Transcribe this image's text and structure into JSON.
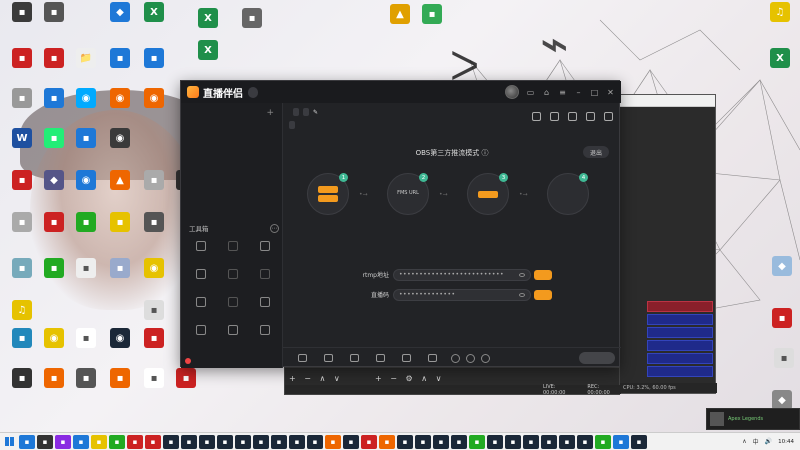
{
  "app": {
    "name": "直播伴侣",
    "version": "",
    "title_icons": [
      "avatar-icon",
      "message-icon",
      "shirt-icon",
      "menu-icon",
      "minimize-icon",
      "maximize-icon",
      "close-icon"
    ]
  },
  "sidebar": {
    "tabs": [
      "",
      "",
      ""
    ],
    "empty_hint": "",
    "tools_title": "工具箱",
    "tools": [
      {
        "label": "",
        "icon": "scene-icon"
      },
      {
        "label": "",
        "icon": "timer-icon"
      },
      {
        "label": "",
        "icon": "voice-icon"
      },
      {
        "label": "",
        "icon": "broadcast-icon"
      },
      {
        "label": "",
        "icon": "gift-icon"
      },
      {
        "label": "",
        "icon": "user-icon"
      },
      {
        "label": "",
        "icon": "tool-icon"
      },
      {
        "label": "",
        "icon": "list-icon"
      },
      {
        "label": "",
        "icon": "record-icon"
      },
      {
        "label": "",
        "icon": "chart-icon"
      },
      {
        "label": "",
        "icon": "hot-icon"
      },
      {
        "label": "",
        "icon": "upload-icon"
      }
    ],
    "footer_text": ""
  },
  "room": {
    "title": "",
    "tag1": "",
    "tag2": "",
    "badge": "",
    "meta1": "",
    "meta2": "",
    "meta3": ""
  },
  "obs_mode": {
    "title": "OBS第三方推流模式",
    "exit_label": "退出",
    "steps": [
      {
        "num": "1",
        "chips": [
          "",
          ""
        ],
        "text": "",
        "caption": ""
      },
      {
        "num": "2",
        "chips": [],
        "text": "FMS URL",
        "text2": "",
        "caption": ""
      },
      {
        "num": "3",
        "chips": [
          ""
        ],
        "text": "",
        "caption": ""
      },
      {
        "num": "4",
        "chips": [],
        "text": "",
        "caption": ""
      }
    ],
    "rtmp_label": "rtmp地址",
    "rtmp_value": "••••••••••••••••••••••••••",
    "key_label": "直播码",
    "key_value": "••••••••••••••",
    "copy_label": "",
    "hint": ""
  },
  "bottom_bar": {
    "items": [
      "",
      "",
      "",
      "",
      "",
      ""
    ],
    "start_label": ""
  },
  "obs": {
    "controls_header": "",
    "buttons": [
      "",
      "",
      "",
      "",
      "",
      ""
    ],
    "status_live": "LIVE: 00:00:00",
    "status_rec": "REC: 00:00:00",
    "status_cpu": "CPU: 3.2%, 60.00 fps",
    "under_controls_a": "+ − ∧ ∨",
    "under_controls_b": "+ − ⚙ ∧ ∨"
  },
  "desktop_icons": [
    {
      "label": "",
      "color": "#3b3b3b",
      "glyph": "▪"
    },
    {
      "label": "",
      "color": "#555",
      "glyph": "▪"
    },
    {
      "label": "",
      "color": "#1e78d7",
      "glyph": "◆"
    },
    {
      "label": "",
      "color": "#1f8f4a",
      "glyph": "X"
    },
    {
      "label": "",
      "color": "#1f8f4a",
      "glyph": "X"
    },
    {
      "label": "",
      "color": "#666",
      "glyph": "▪"
    },
    {
      "label": "",
      "color": "#e0a000",
      "glyph": "▲"
    },
    {
      "label": "",
      "color": "#3a5",
      "glyph": "▪"
    },
    {
      "label": "",
      "color": "#e6c200",
      "glyph": "♫"
    },
    {
      "label": "",
      "color": "#c22",
      "glyph": "▪"
    },
    {
      "label": "",
      "color": "#c22",
      "glyph": "▪"
    },
    {
      "label": "",
      "color": "#eee",
      "glyph": "📁"
    },
    {
      "label": "",
      "color": "#1e78d7",
      "glyph": "▪"
    },
    {
      "label": "",
      "color": "#1e78d7",
      "glyph": "▪"
    },
    {
      "label": "",
      "color": "#1f8f4a",
      "glyph": "X"
    },
    {
      "label": "",
      "color": "#1f8f4a",
      "glyph": "X"
    },
    {
      "label": "",
      "color": "#999",
      "glyph": "▪"
    },
    {
      "label": "",
      "color": "#1e78d7",
      "glyph": "▪"
    },
    {
      "label": "",
      "color": "#0af",
      "glyph": "◉"
    },
    {
      "label": "",
      "color": "#e60",
      "glyph": "◉"
    },
    {
      "label": "",
      "color": "#e60",
      "glyph": "◉"
    },
    {
      "label": "",
      "color": "#1e50a0",
      "glyph": "W"
    },
    {
      "label": "",
      "color": "#2e7",
      "glyph": "▪"
    },
    {
      "label": "",
      "color": "#1e78d7",
      "glyph": "▪"
    },
    {
      "label": "",
      "color": "#3a3a3a",
      "glyph": "◉"
    },
    {
      "label": "",
      "color": "#c22",
      "glyph": "▪"
    },
    {
      "label": "",
      "color": "#558",
      "glyph": "◆"
    },
    {
      "label": "",
      "color": "#1e78d7",
      "glyph": "◉"
    },
    {
      "label": "",
      "color": "#e60",
      "glyph": "▲"
    },
    {
      "label": "",
      "color": "#aaa",
      "glyph": "▪"
    },
    {
      "label": "",
      "color": "#333",
      "glyph": "▪"
    },
    {
      "label": "",
      "color": "#aaa",
      "glyph": "▪"
    },
    {
      "label": "",
      "color": "#c22",
      "glyph": "▪"
    },
    {
      "label": "",
      "color": "#2a2",
      "glyph": "▪"
    },
    {
      "label": "",
      "color": "#e6c200",
      "glyph": "▪"
    },
    {
      "label": "",
      "color": "#555",
      "glyph": "▪"
    },
    {
      "label": "",
      "color": "#7ab",
      "glyph": "▪"
    },
    {
      "label": "",
      "color": "#2a2",
      "glyph": "▪"
    },
    {
      "label": "",
      "color": "#eee",
      "glyph": "▪"
    },
    {
      "label": "",
      "color": "#9ac",
      "glyph": "▪"
    },
    {
      "label": "",
      "color": "#e6c200",
      "glyph": "◉"
    },
    {
      "label": "",
      "color": "#28b",
      "glyph": "▪"
    },
    {
      "label": "",
      "color": "#e6c200",
      "glyph": "◉"
    },
    {
      "label": "",
      "color": "#fff",
      "glyph": "▪"
    },
    {
      "label": "",
      "color": "#1b2838",
      "glyph": "◉"
    },
    {
      "label": "",
      "color": "#c22",
      "glyph": "▪"
    },
    {
      "label": "",
      "color": "#c22",
      "glyph": "▪"
    },
    {
      "label": "",
      "color": "#333",
      "glyph": "▪"
    },
    {
      "label": "",
      "color": "#e60",
      "glyph": "▪"
    },
    {
      "label": "",
      "color": "#555",
      "glyph": "▪"
    },
    {
      "label": "",
      "color": "#e60",
      "glyph": "▪"
    },
    {
      "label": "",
      "color": "#fff",
      "glyph": "▪"
    },
    {
      "label": "",
      "color": "#c22",
      "glyph": "▪"
    },
    {
      "label": "",
      "color": "#ddd",
      "glyph": "▪"
    },
    {
      "label": "",
      "color": "#e6c200",
      "glyph": "♫"
    },
    {
      "label": "",
      "color": "#ddd",
      "glyph": "▪"
    },
    {
      "label": "",
      "color": "#9bd",
      "glyph": "◆"
    },
    {
      "label": "",
      "color": "#888",
      "glyph": "◆"
    }
  ],
  "taskbar": {
    "apps": [
      "#1e78d7",
      "#333",
      "#8a2be2",
      "#1e78d7",
      "#e6c200",
      "#2a2",
      "#c22",
      "#c22",
      "#1b2838",
      "#1b2838",
      "#1b2838",
      "#1b2838",
      "#1b2838",
      "#1b2838",
      "#1b2838",
      "#1b2838",
      "#1b2838",
      "#e60",
      "#1b2838",
      "#c22",
      "#e60",
      "#1b2838",
      "#1b2838",
      "#1b2838",
      "#1b2838",
      "#2a2",
      "#1b2838",
      "#1b2838",
      "#1b2838",
      "#1b2838",
      "#1b2838",
      "#1b2838",
      "#2a2",
      "#1e78d7",
      "#1b2838"
    ],
    "tray": [
      "∧",
      "中",
      "🔊"
    ],
    "time": "10:44",
    "date": ""
  },
  "notify": {
    "name": "",
    "status": "",
    "game": "Apex Legends"
  }
}
